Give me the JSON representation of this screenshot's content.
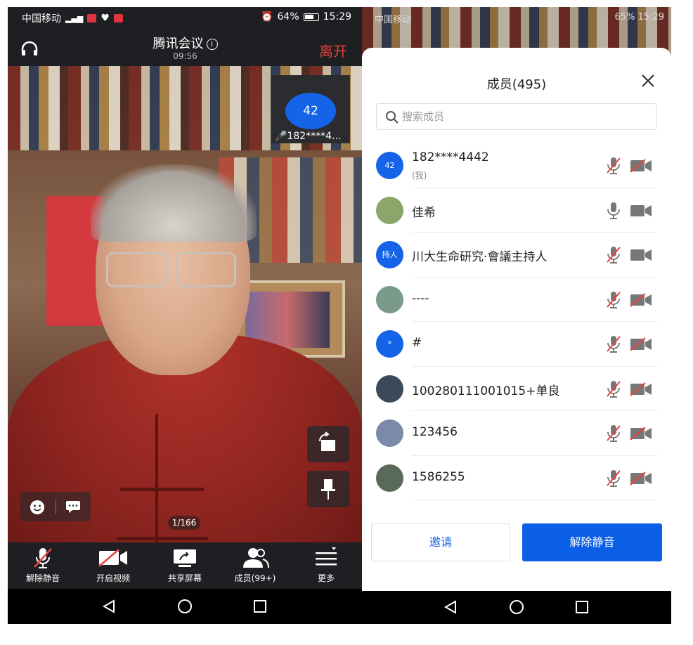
{
  "left": {
    "status": {
      "carrier": "中国移动",
      "battery": "64%",
      "time": "15:29"
    },
    "meeting": {
      "title": "腾讯会议",
      "duration": "09:56",
      "leave_label": "离开"
    },
    "self_tile": {
      "avatar_text": "42",
      "name": "182****4..."
    },
    "pager": "1/166",
    "toolbar": [
      {
        "label": "解除静音",
        "icon": "mic-muted-icon"
      },
      {
        "label": "开启视频",
        "icon": "camera-off-icon"
      },
      {
        "label": "共享屏幕",
        "icon": "share-screen-icon"
      },
      {
        "label": "成员(99+)",
        "icon": "members-icon"
      },
      {
        "label": "更多",
        "icon": "more-icon"
      }
    ]
  },
  "right": {
    "status": {
      "carrier": "中国移动",
      "battery": "65%",
      "time": "15:29"
    },
    "panel": {
      "title": "成员(495)",
      "search_placeholder": "搜索成员",
      "invite_label": "邀请",
      "unmute_label": "解除静音"
    },
    "members": [
      {
        "name": "182****4442",
        "sub": "(我)",
        "avatar_text": "42",
        "avatar_color": "#1463e8",
        "mic": "muted",
        "cam": "off"
      },
      {
        "name": "佳希",
        "sub": "",
        "avatar_text": "",
        "avatar_color": "#8aa66a",
        "mic": "on",
        "cam": "on"
      },
      {
        "name": "川大生命研究·會議主持人",
        "sub": "",
        "avatar_text": "持人",
        "avatar_color": "#1463e8",
        "mic": "muted",
        "cam": "on"
      },
      {
        "name": "----",
        "sub": "",
        "avatar_text": "",
        "avatar_color": "#7a9a8a",
        "mic": "muted",
        "cam": "off"
      },
      {
        "name": "#",
        "sub": "",
        "avatar_text": "*",
        "avatar_color": "#1463e8",
        "mic": "muted",
        "cam": "off"
      },
      {
        "name": "100280111001015+单良",
        "sub": "",
        "avatar_text": "",
        "avatar_color": "#3a4a5a",
        "mic": "muted",
        "cam": "off"
      },
      {
        "name": "123456",
        "sub": "",
        "avatar_text": "",
        "avatar_color": "#7a8aa8",
        "mic": "muted",
        "cam": "off"
      },
      {
        "name": "1586255",
        "sub": "",
        "avatar_text": "",
        "avatar_color": "#5a6a5a",
        "mic": "muted",
        "cam": "off"
      }
    ]
  }
}
